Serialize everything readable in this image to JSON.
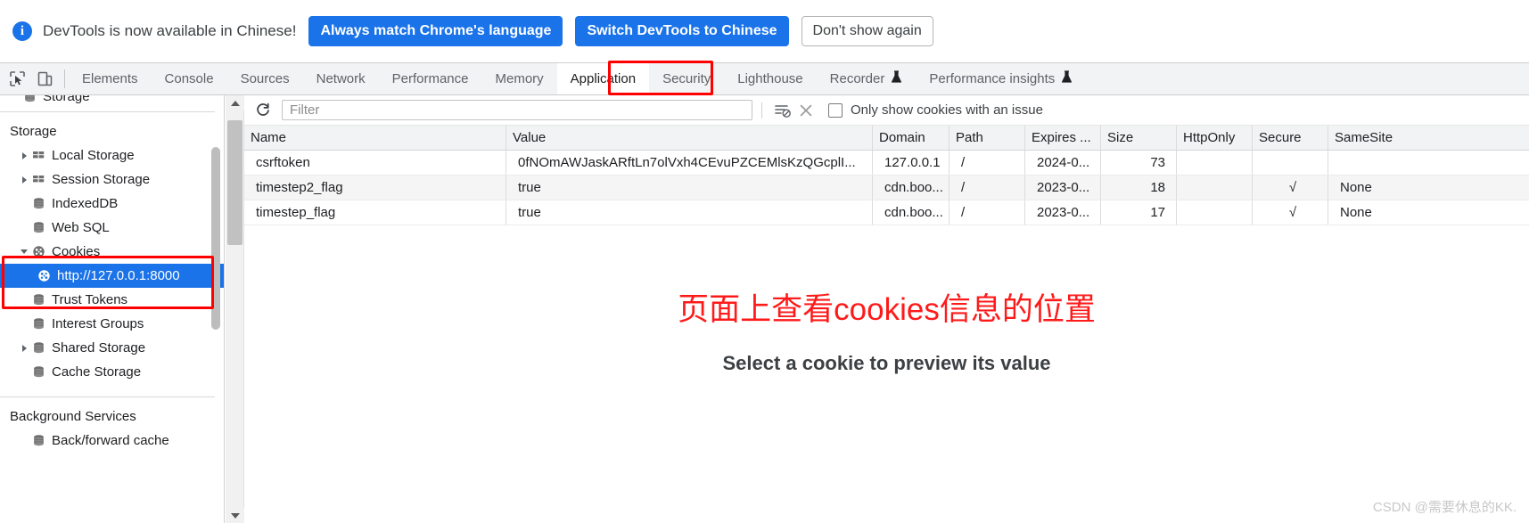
{
  "infobar": {
    "icon": "info-icon",
    "message": "DevTools is now available in Chinese!",
    "buttons": [
      {
        "label": "Always match Chrome's language",
        "style": "primary"
      },
      {
        "label": "Switch DevTools to Chinese",
        "style": "primary"
      },
      {
        "label": "Don't show again",
        "style": "secondary"
      }
    ]
  },
  "tabstrip": {
    "tools": [
      {
        "name": "inspect-element-icon"
      },
      {
        "name": "device-toolbar-icon"
      }
    ],
    "tabs": [
      {
        "label": "Elements",
        "active": false,
        "flask": false
      },
      {
        "label": "Console",
        "active": false,
        "flask": false
      },
      {
        "label": "Sources",
        "active": false,
        "flask": false
      },
      {
        "label": "Network",
        "active": false,
        "flask": false
      },
      {
        "label": "Performance",
        "active": false,
        "flask": false
      },
      {
        "label": "Memory",
        "active": false,
        "flask": false
      },
      {
        "label": "Application",
        "active": true,
        "flask": false
      },
      {
        "label": "Security",
        "active": false,
        "flask": false
      },
      {
        "label": "Lighthouse",
        "active": false,
        "flask": false
      },
      {
        "label": "Recorder",
        "active": false,
        "flask": true
      },
      {
        "label": "Performance insights",
        "active": false,
        "flask": true
      }
    ]
  },
  "sidebar": {
    "clipped_top_item": {
      "label": "Storage",
      "icon": "database-icon"
    },
    "section_storage": "Storage",
    "storage_items": [
      {
        "label": "Local Storage",
        "icon": "table-icon",
        "twisty": "right",
        "indent": 0,
        "selected": false
      },
      {
        "label": "Session Storage",
        "icon": "table-icon",
        "twisty": "right",
        "indent": 0,
        "selected": false
      },
      {
        "label": "IndexedDB",
        "icon": "database-icon",
        "twisty": "none",
        "indent": 0,
        "selected": false
      },
      {
        "label": "Web SQL",
        "icon": "database-icon",
        "twisty": "none",
        "indent": 0,
        "selected": false
      },
      {
        "label": "Cookies",
        "icon": "cookie-icon",
        "twisty": "down",
        "indent": 0,
        "selected": false
      },
      {
        "label": "http://127.0.0.1:8000",
        "icon": "cookie-icon",
        "twisty": "none",
        "indent": 1,
        "selected": true
      },
      {
        "label": "Trust Tokens",
        "icon": "database-icon",
        "twisty": "none",
        "indent": 0,
        "selected": false
      },
      {
        "label": "Interest Groups",
        "icon": "database-icon",
        "twisty": "none",
        "indent": 0,
        "selected": false
      },
      {
        "label": "Shared Storage",
        "icon": "database-icon",
        "twisty": "right",
        "indent": 0,
        "selected": false
      },
      {
        "label": "Cache Storage",
        "icon": "database-icon",
        "twisty": "none",
        "indent": 0,
        "selected": false
      }
    ],
    "section_background": "Background Services",
    "background_items": [
      {
        "label": "Back/forward cache",
        "icon": "database-icon",
        "twisty": "none",
        "indent": 0,
        "selected": false
      }
    ]
  },
  "toolbar": {
    "refresh_icon": "refresh-icon",
    "filter_placeholder": "Filter",
    "filter_value": "",
    "clear_filter_icon": "clear-filter-icon",
    "clear_all_icon": "close-x-icon",
    "issue_checkbox_label": "Only show cookies with an issue",
    "issue_checkbox_checked": false
  },
  "table": {
    "columns": [
      "Name",
      "Value",
      "Domain",
      "Path",
      "Expires ...",
      "Size",
      "HttpOnly",
      "Secure",
      "SameSite"
    ],
    "rows": [
      {
        "name": "csrftoken",
        "value": "0fNOmAWJaskARftLn7olVxh4CEvuPZCEMlsKzQGcplI...",
        "domain": "127.0.0.1",
        "path": "/",
        "expires": "2024-0...",
        "size": "73",
        "httponly": "",
        "secure": "",
        "samesite": ""
      },
      {
        "name": "timestep2_flag",
        "value": "true",
        "domain": "cdn.boo...",
        "path": "/",
        "expires": "2023-0...",
        "size": "18",
        "httponly": "",
        "secure": "√",
        "samesite": "None"
      },
      {
        "name": "timestep_flag",
        "value": "true",
        "domain": "cdn.boo...",
        "path": "/",
        "expires": "2023-0...",
        "size": "17",
        "httponly": "",
        "secure": "√",
        "samesite": "None"
      }
    ]
  },
  "preview": {
    "annotation_cn": "页面上查看cookies信息的位置",
    "message": "Select a cookie to preview its value"
  },
  "watermark": "CSDN @需要休息的KK.",
  "colors": {
    "accent_blue": "#1a73e8",
    "highlight_red": "#ff0000",
    "annotation_red": "#ff1a1a",
    "tabstrip_bg": "#f1f3f4",
    "row_alt_bg": "#f5f5f5"
  }
}
